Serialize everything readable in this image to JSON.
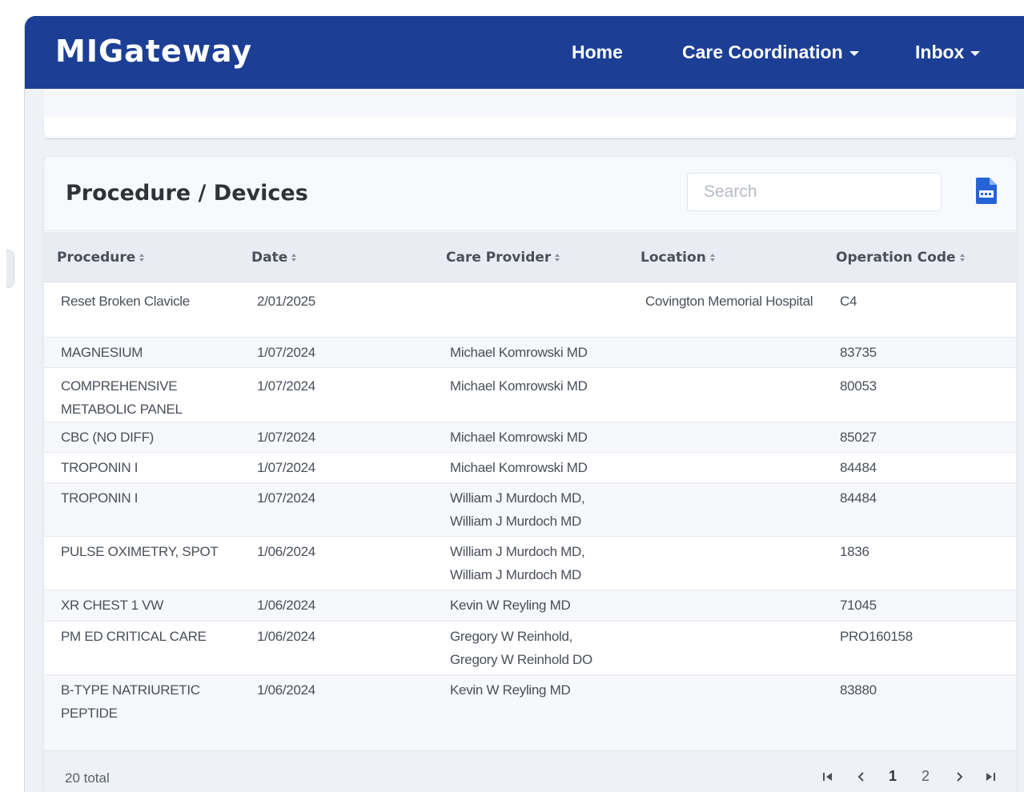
{
  "app": {
    "logo_text": "MIGateway",
    "nav": {
      "home": "Home",
      "care_coordination": "Care Coordination",
      "inbox": "Inbox"
    }
  },
  "colors": {
    "navbar": "#1c3f95",
    "csv_icon": "#2563d6"
  },
  "section": {
    "title": "Procedure / Devices",
    "search_placeholder": "Search",
    "export_icon": "csv-file-icon"
  },
  "table": {
    "columns": [
      "Procedure",
      "Date",
      "Care Provider",
      "Location",
      "Operation Code"
    ],
    "rows": [
      {
        "procedure": "Reset Broken Clavicle",
        "date": "2/01/2025",
        "provider": "",
        "location": "Covington Memorial Hospital",
        "code": "C4"
      },
      {
        "procedure": "MAGNESIUM",
        "date": "1/07/2024",
        "provider": "Michael Komrowski MD",
        "location": "",
        "code": "83735"
      },
      {
        "procedure": "COMPREHENSIVE METABOLIC PANEL",
        "date": "1/07/2024",
        "provider": "Michael Komrowski MD",
        "location": "",
        "code": "80053"
      },
      {
        "procedure": "CBC (NO DIFF)",
        "date": "1/07/2024",
        "provider": "Michael Komrowski MD",
        "location": "",
        "code": "85027"
      },
      {
        "procedure": "TROPONIN I",
        "date": "1/07/2024",
        "provider": "Michael Komrowski MD",
        "location": "",
        "code": "84484"
      },
      {
        "procedure": "TROPONIN I",
        "date": "1/07/2024",
        "provider": "William J Murdoch MD, William J Murdoch MD",
        "location": "",
        "code": "84484"
      },
      {
        "procedure": "PULSE OXIMETRY, SPOT",
        "date": "1/06/2024",
        "provider": "William J Murdoch MD, William J Murdoch MD",
        "location": "",
        "code": "1836"
      },
      {
        "procedure": "XR CHEST 1 VW",
        "date": "1/06/2024",
        "provider": "Kevin W Reyling MD",
        "location": "",
        "code": "71045"
      },
      {
        "procedure": "PM ED CRITICAL CARE",
        "date": "1/06/2024",
        "provider": "Gregory W Reinhold, Gregory W Reinhold DO",
        "location": "",
        "code": "PRO160158"
      },
      {
        "procedure": "B-TYPE NATRIURETIC PEPTIDE",
        "date": "1/06/2024",
        "provider": "Kevin W Reyling MD",
        "location": "",
        "code": "83880"
      }
    ]
  },
  "footer": {
    "total": "20 total",
    "pages": [
      "1",
      "2"
    ],
    "current_page": "1"
  }
}
